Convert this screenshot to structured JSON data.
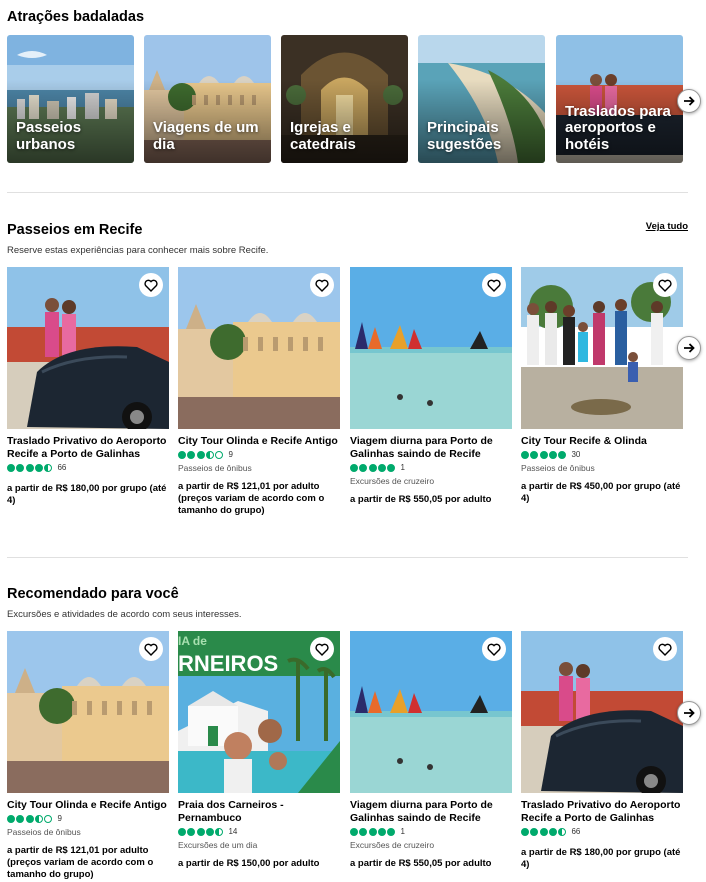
{
  "attractions": {
    "title": "Atrações badaladas",
    "items": [
      {
        "label": "Passeios urbanos"
      },
      {
        "label": "Viagens de um dia"
      },
      {
        "label": "Igrejas e catedrais"
      },
      {
        "label": "Principais sugestões"
      },
      {
        "label": "Traslados para aeroportos e hotéis"
      }
    ]
  },
  "tours": {
    "title": "Passeios em Recife",
    "subtitle": "Reserve estas experiências para conhecer mais sobre Recife.",
    "see_all": "Veja tudo",
    "cards": [
      {
        "name": "Traslado Privativo do Aeroporto Recife a Porto de Galinhas",
        "rating": 4.5,
        "reviews": "66",
        "category": "",
        "price": "a partir de R$ 180,00 por grupo (até 4)"
      },
      {
        "name": "City Tour Olinda e Recife Antigo",
        "rating": 3.5,
        "reviews": "9",
        "category": "Passeios de ônibus",
        "price": "a partir de R$ 121,01 por adulto (preços variam de acordo com o tamanho do grupo)"
      },
      {
        "name": "Viagem diurna para Porto de Galinhas saindo de Recife",
        "rating": 5,
        "reviews": "1",
        "category": "Excursões de cruzeiro",
        "price": "a partir de R$ 550,05 por adulto"
      },
      {
        "name": "City Tour Recife & Olinda",
        "rating": 5,
        "reviews": "30",
        "category": "Passeios de ônibus",
        "price": "a partir de R$ 450,00 por grupo (até 4)"
      }
    ]
  },
  "recommended": {
    "title": "Recomendado para você",
    "subtitle": "Excursões e atividades de acordo com seus interesses.",
    "cards": [
      {
        "name": "City Tour Olinda e Recife Antigo",
        "rating": 3.5,
        "reviews": "9",
        "category": "Passeios de ônibus",
        "price": "a partir de R$ 121,01 por adulto (preços variam de acordo com o tamanho do grupo)"
      },
      {
        "name": "Praia dos Carneiros - Pernambuco",
        "rating": 4.5,
        "reviews": "14",
        "category": "Excursões de um dia",
        "price": "a partir de R$ 150,00 por adulto",
        "banner": "IA de RNEIROS"
      },
      {
        "name": "Viagem diurna para Porto de Galinhas saindo de Recife",
        "rating": 5,
        "reviews": "1",
        "category": "Excursões de cruzeiro",
        "price": "a partir de R$ 550,05 por adulto"
      },
      {
        "name": "Traslado Privativo do Aeroporto Recife a Porto de Galinhas",
        "rating": 4.5,
        "reviews": "66",
        "category": "",
        "price": "a partir de R$ 180,00 por grupo (até 4)"
      }
    ]
  },
  "icons": {
    "heart": "heart-icon",
    "next": "chevron-right-icon"
  },
  "colors": {
    "rating": "#00aa6c"
  }
}
